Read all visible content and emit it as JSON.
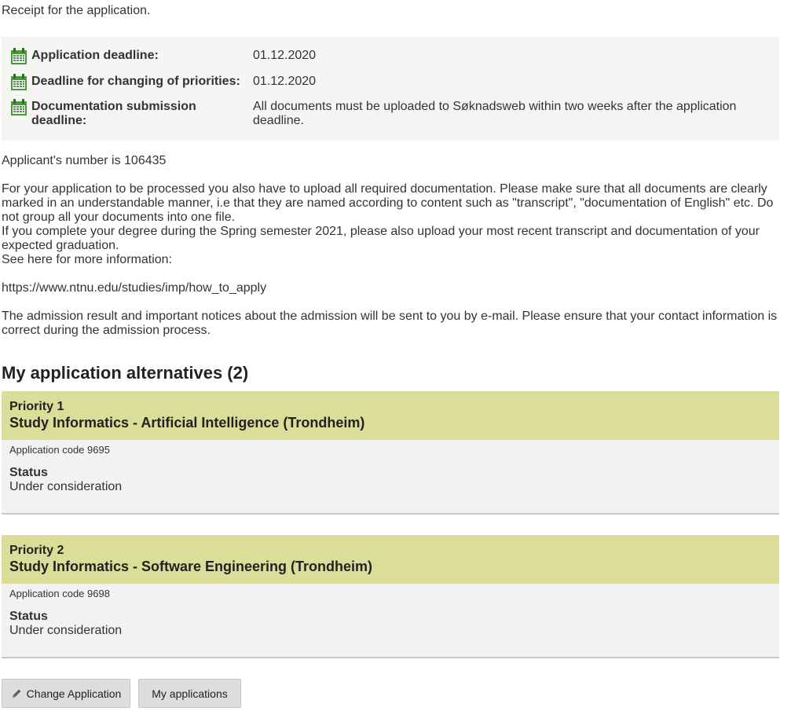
{
  "receipt_intro": "Receipt for the application.",
  "deadlines": [
    {
      "icon": "calendar-icon",
      "label": "Application deadline:",
      "value": "01.12.2020"
    },
    {
      "icon": "calendar-icon",
      "label": "Deadline for changing of priorities:",
      "value": "01.12.2020"
    },
    {
      "icon": "calendar-icon",
      "label": "Documentation submission deadline:",
      "value": "All documents must be uploaded to Søknadsweb within two weeks after the application deadline."
    }
  ],
  "applicant_number_text": "Applicant's number is 106435",
  "documentation_text": "For your application to be processed you also have to upload all required documentation. Please make sure that all documents are clearly marked in an understandable manner, i.e that they are named according to content such as \"transcript\", \"documentation of English\" etc. Do not group all your documents into one file.",
  "graduation_text": "If you complete your degree during the Spring semester 2021, please also upload your most recent transcript and documentation of your expected graduation.",
  "more_info_text": "See here for more information:",
  "info_url": "https://www.ntnu.edu/studies/imp/how_to_apply",
  "notice_text": "The admission result and important notices about the admission will be sent to you by e-mail. Please ensure that your contact information is correct during the admission process.",
  "alternatives_title": "My application alternatives (2)",
  "alternatives": [
    {
      "priority": "Priority 1",
      "name": "Study Informatics - Artificial Intelligence (Trondheim)",
      "code": "Application code 9695",
      "status_label": "Status",
      "status_value": "Under consideration"
    },
    {
      "priority": "Priority 2",
      "name": "Study Informatics - Software Engineering (Trondheim)",
      "code": "Application code 9698",
      "status_label": "Status",
      "status_value": "Under consideration"
    }
  ],
  "buttons": {
    "change_application": "Change Application",
    "change_application_icon": "pencil-icon",
    "my_applications": "My applications"
  },
  "colors": {
    "alt_header_bg": "#dade98",
    "calendar_green": "#4a9a3c"
  }
}
